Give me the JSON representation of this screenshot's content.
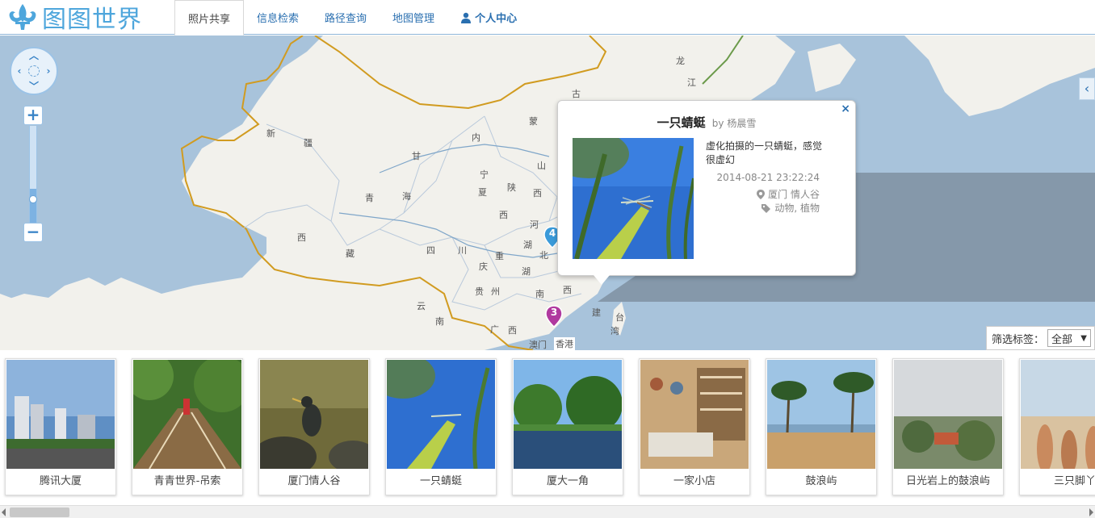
{
  "app": {
    "logo_text": "图图世界"
  },
  "nav": {
    "items": [
      {
        "label": "照片共享",
        "active": true
      },
      {
        "label": "信息检索"
      },
      {
        "label": "路径查询"
      },
      {
        "label": "地图管理"
      },
      {
        "label": "个人中心",
        "icon": "user-icon"
      }
    ]
  },
  "map": {
    "labels": [
      "新",
      "疆",
      "甘",
      "青",
      "海",
      "西",
      "藏",
      "宁",
      "夏",
      "陕",
      "西",
      "山",
      "西",
      "河",
      "四",
      "川",
      "重",
      "庆",
      "贵",
      "州",
      "湖",
      "北",
      "湖",
      "南",
      "西",
      "云",
      "南",
      "广",
      "西",
      "建",
      "台",
      "湾",
      "香港",
      "澳门",
      "内",
      "蒙",
      "古",
      "龙",
      "江"
    ],
    "markers": [
      {
        "count": "4",
        "color": "#3a9ad9"
      },
      {
        "count": "3",
        "color": "#b0399f"
      }
    ]
  },
  "popup": {
    "title": "一只蜻蜓",
    "by": "by 杨晨雪",
    "description": "虚化拍摄的一只蜻蜓，感觉很虚幻",
    "time": "2014-08-21 23:22:24",
    "location": "厦门 情人谷",
    "tags": "动物, 植物",
    "close": "×"
  },
  "filter": {
    "label": "筛选标签：",
    "selected": "全部"
  },
  "thumbnails": [
    {
      "caption": "腾讯大厦"
    },
    {
      "caption": "青青世界-吊索"
    },
    {
      "caption": "厦门情人谷"
    },
    {
      "caption": "一只蜻蜓"
    },
    {
      "caption": "厦大一角"
    },
    {
      "caption": "一家小店"
    },
    {
      "caption": "鼓浪屿"
    },
    {
      "caption": "日光岩上的鼓浪屿"
    },
    {
      "caption": "三只脚丫"
    }
  ],
  "colors": {
    "accent": "#2a6fb0",
    "logo": "#4ea6dc",
    "sea": "#a8c3db",
    "land": "#f2f1ec",
    "border": "#d19b20"
  }
}
